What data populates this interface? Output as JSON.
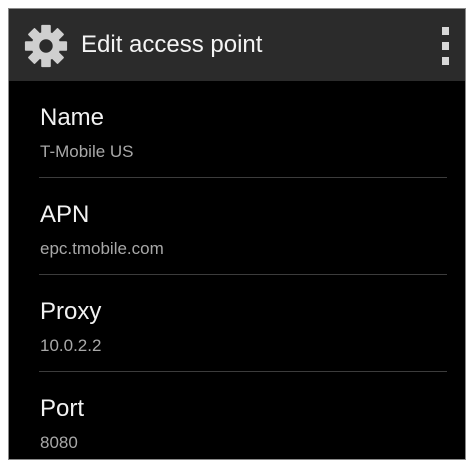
{
  "action_bar": {
    "icon": "settings-gear-icon",
    "title": "Edit access point",
    "overflow_icon": "overflow-menu-icon"
  },
  "preferences": [
    {
      "title": "Name",
      "summary": "T-Mobile US"
    },
    {
      "title": "APN",
      "summary": "epc.tmobile.com"
    },
    {
      "title": "Proxy",
      "summary": "10.0.2.2"
    },
    {
      "title": "Port",
      "summary": "8080"
    }
  ],
  "colors": {
    "background": "#000000",
    "action_bar": "#2b2b2b",
    "title_text": "#f2f2f2",
    "summary_text": "#a8a8a8",
    "divider": "#3c3c3c"
  }
}
